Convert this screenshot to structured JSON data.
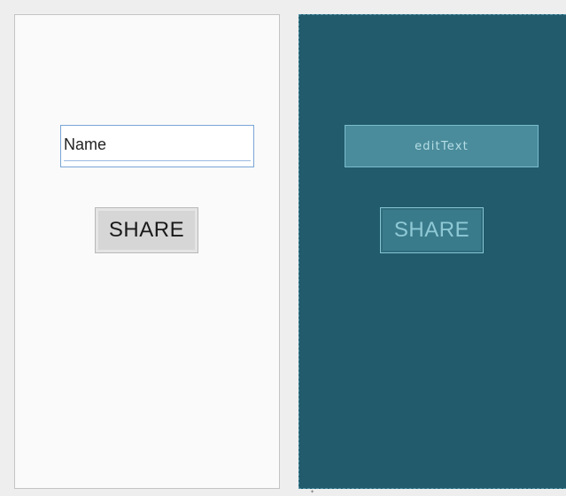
{
  "design_view": {
    "edit_text": {
      "value": "Name"
    },
    "share_button": {
      "label": "SHARE"
    }
  },
  "blueprint_view": {
    "edit_text": {
      "label": "editText"
    },
    "share_button": {
      "label": "SHARE"
    }
  },
  "colors": {
    "design_background": "#fafafa",
    "blueprint_background": "#225b6c",
    "blueprint_widget": "#4a8c9b",
    "blueprint_outline": "#79bccc",
    "edit_text_border": "#7aa6d6"
  }
}
